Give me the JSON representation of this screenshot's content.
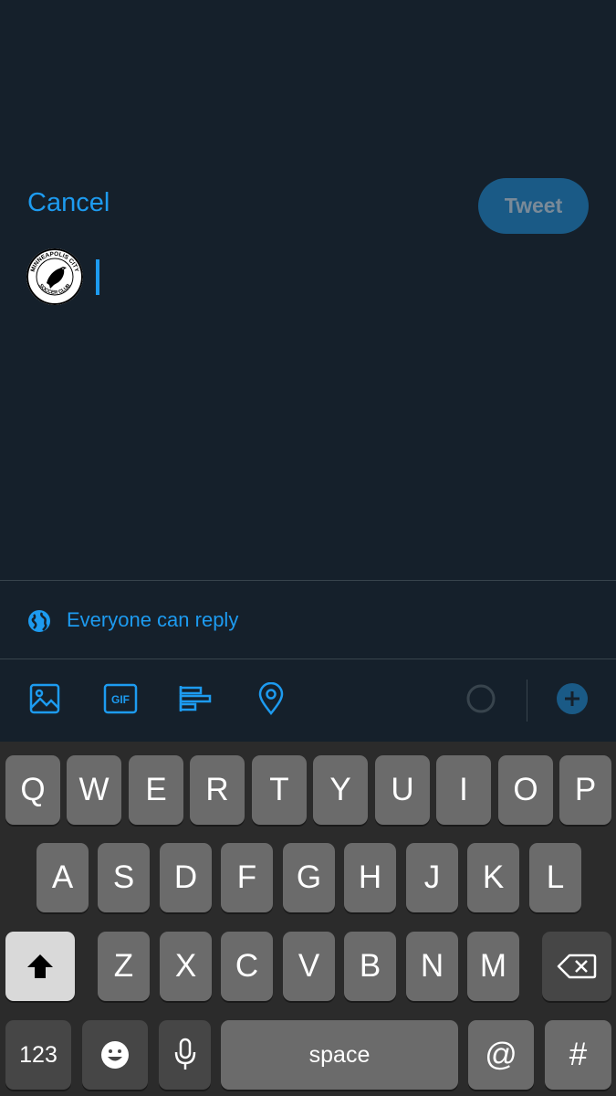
{
  "header": {
    "cancel_label": "Cancel",
    "tweet_label": "Tweet"
  },
  "avatar": {
    "text_top": "MINNEAPOLIS CITY",
    "text_bottom": "SOCCER CLUB",
    "icon": "crow-logo-icon"
  },
  "reply": {
    "label": "Everyone can reply",
    "icon": "globe-icon"
  },
  "toolbar": {
    "items": [
      "image-icon",
      "gif-icon",
      "poll-icon",
      "location-icon",
      "progress-ring-icon",
      "add-tweet-icon"
    ],
    "gif_text": "GIF"
  },
  "keyboard": {
    "row1": [
      "Q",
      "W",
      "E",
      "R",
      "T",
      "Y",
      "U",
      "I",
      "O",
      "P"
    ],
    "row2": [
      "A",
      "S",
      "D",
      "F",
      "G",
      "H",
      "J",
      "K",
      "L"
    ],
    "row3": [
      "Z",
      "X",
      "C",
      "V",
      "B",
      "N",
      "M"
    ],
    "numbers_label": "123",
    "space_label": "space",
    "at_label": "@",
    "hash_label": "#"
  },
  "colors": {
    "background": "#15202b",
    "accent": "#1d9bf0",
    "tweet_button_disabled": "#1a5a86",
    "keyboard_bg": "#2b2b2b",
    "key_bg": "#6b6b6b"
  }
}
